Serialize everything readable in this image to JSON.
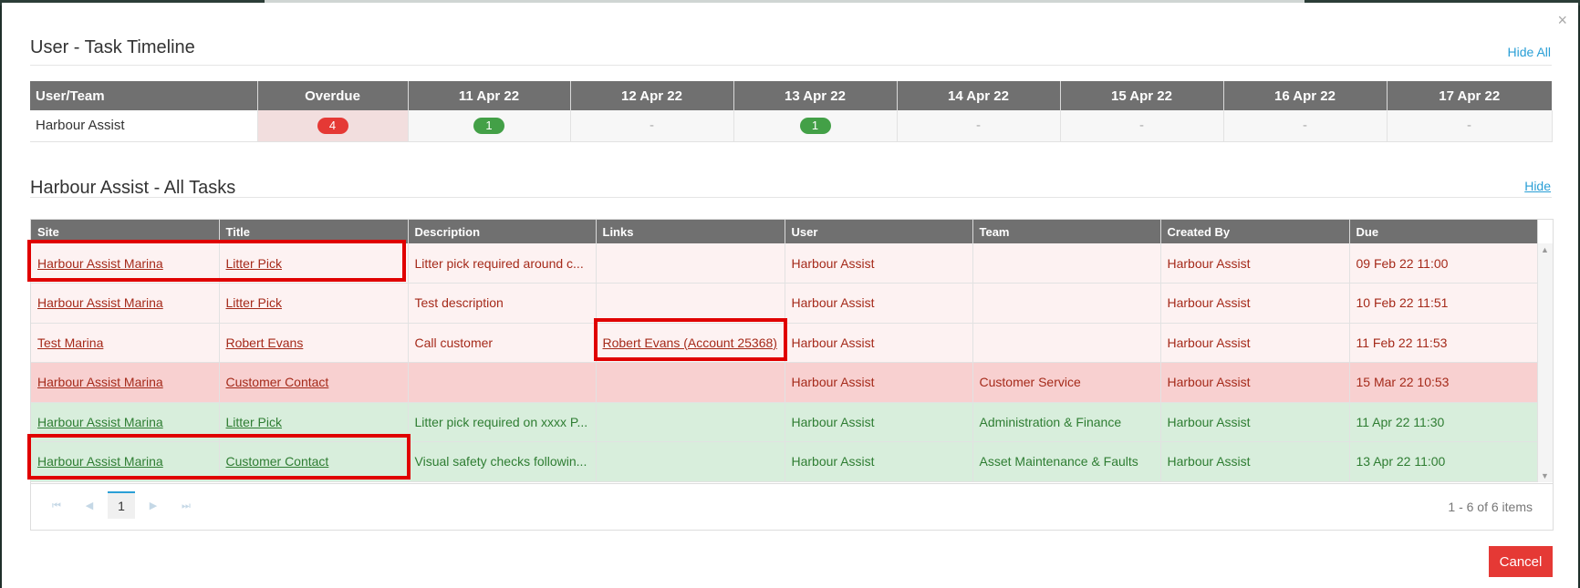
{
  "modal": {
    "close_symbol": "×",
    "cancel_label": "Cancel"
  },
  "timeline": {
    "title": "User - Task Timeline",
    "hide_all_label": "Hide All",
    "columns": [
      "User/Team",
      "Overdue",
      "11 Apr 22",
      "12 Apr 22",
      "13 Apr 22",
      "14 Apr 22",
      "15 Apr 22",
      "16 Apr 22",
      "17 Apr 22"
    ],
    "row": {
      "user": "Harbour Assist",
      "overdue": "4",
      "cells": [
        "1",
        "-",
        "1",
        "-",
        "-",
        "-",
        "-"
      ]
    }
  },
  "tasks": {
    "title": "Harbour Assist - All Tasks",
    "hide_label": "Hide",
    "columns": [
      "Site",
      "Title",
      "Description",
      "Links",
      "User",
      "Team",
      "Created By",
      "Due"
    ],
    "rows": [
      {
        "site": "Harbour Assist Marina",
        "title": "Litter Pick",
        "description": "Litter pick required around c...",
        "links": "",
        "user": "Harbour Assist",
        "team": "",
        "created_by": "Harbour Assist",
        "due": "09 Feb 22 11:00",
        "status": "overdue"
      },
      {
        "site": "Harbour Assist Marina",
        "title": "Litter Pick",
        "description": "Test description",
        "links": "",
        "user": "Harbour Assist",
        "team": "",
        "created_by": "Harbour Assist",
        "due": "10 Feb 22 11:51",
        "status": "overdue"
      },
      {
        "site": "Test Marina",
        "title": "Robert Evans",
        "description": "Call customer",
        "links": "Robert Evans (Account 25368)",
        "user": "Harbour Assist",
        "team": "",
        "created_by": "Harbour Assist",
        "due": "11 Feb 22 11:53",
        "status": "overdue"
      },
      {
        "site": "Harbour Assist Marina",
        "title": "Customer Contact",
        "description": "",
        "links": "",
        "user": "Harbour Assist",
        "team": "Customer Service",
        "created_by": "Harbour Assist",
        "due": "15 Mar 22 10:53",
        "status": "overdue-strong"
      },
      {
        "site": "Harbour Assist Marina",
        "title": "Litter Pick",
        "description": "Litter pick required on xxxx P...",
        "links": "",
        "user": "Harbour Assist",
        "team": "Administration & Finance",
        "created_by": "Harbour Assist",
        "due": "11 Apr 22 11:30",
        "status": "upcoming"
      },
      {
        "site": "Harbour Assist Marina",
        "title": "Customer Contact",
        "description": "Visual safety checks followin...",
        "links": "",
        "user": "Harbour Assist",
        "team": "Asset Maintenance & Faults",
        "created_by": "Harbour Assist",
        "due": "13 Apr 22 11:00",
        "status": "upcoming"
      }
    ],
    "pager": {
      "first": "⏮",
      "prev": "◀",
      "current_page": "1",
      "next": "▶",
      "last": "⏭",
      "items_info": "1 - 6 of 6 items"
    },
    "scroll_up": "▲",
    "scroll_down": "▼"
  },
  "colors": {
    "header_bg": "#707070",
    "overdue_row": "#fdf2f2",
    "overdue_strong_row": "#f8d0d0",
    "upcoming_row": "#d8eedc",
    "link": "#2a9fd6",
    "cancel": "#e53935",
    "highlight": "#e00000"
  }
}
